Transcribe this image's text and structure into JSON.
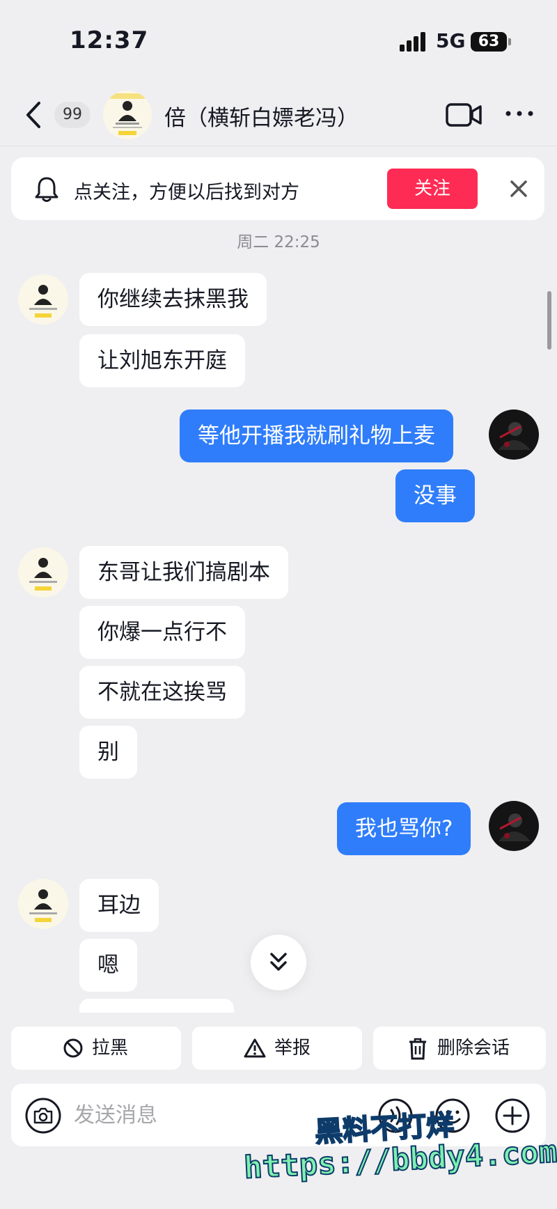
{
  "status_bar": {
    "time": "12:37",
    "network": "5G",
    "battery": "63"
  },
  "header": {
    "unread_count": "99",
    "contact_name": "倍（横斩白嫖老冯）"
  },
  "follow_banner": {
    "text": "点关注，方便以后找到对方",
    "button_label": "关注"
  },
  "timestamp": "周二 22:25",
  "messages": [
    {
      "side": "in",
      "text": "你继续去抹黑我"
    },
    {
      "side": "in",
      "text": "让刘旭东开庭"
    },
    {
      "side": "out",
      "text": "等他开播我就刷礼物上麦"
    },
    {
      "side": "out",
      "text": "没事"
    },
    {
      "side": "in",
      "text": "东哥让我们搞剧本"
    },
    {
      "side": "in",
      "text": "你爆一点行不"
    },
    {
      "side": "in",
      "text": "不就在这挨骂"
    },
    {
      "side": "in",
      "text": "别"
    },
    {
      "side": "out",
      "text": "我也骂你?"
    },
    {
      "side": "in",
      "text": "耳边"
    },
    {
      "side": "in",
      "text": "嗯"
    }
  ],
  "actions": {
    "block": "拉黑",
    "report": "举报",
    "delete": "删除会话"
  },
  "input": {
    "placeholder": "发送消息"
  },
  "watermark": {
    "line1": "黑料不打烊",
    "line2": "https://bbdy4.com"
  },
  "colors": {
    "accent_red": "#fe2c55",
    "bubble_blue": "#2f7dfb",
    "background": "#efeff1"
  }
}
